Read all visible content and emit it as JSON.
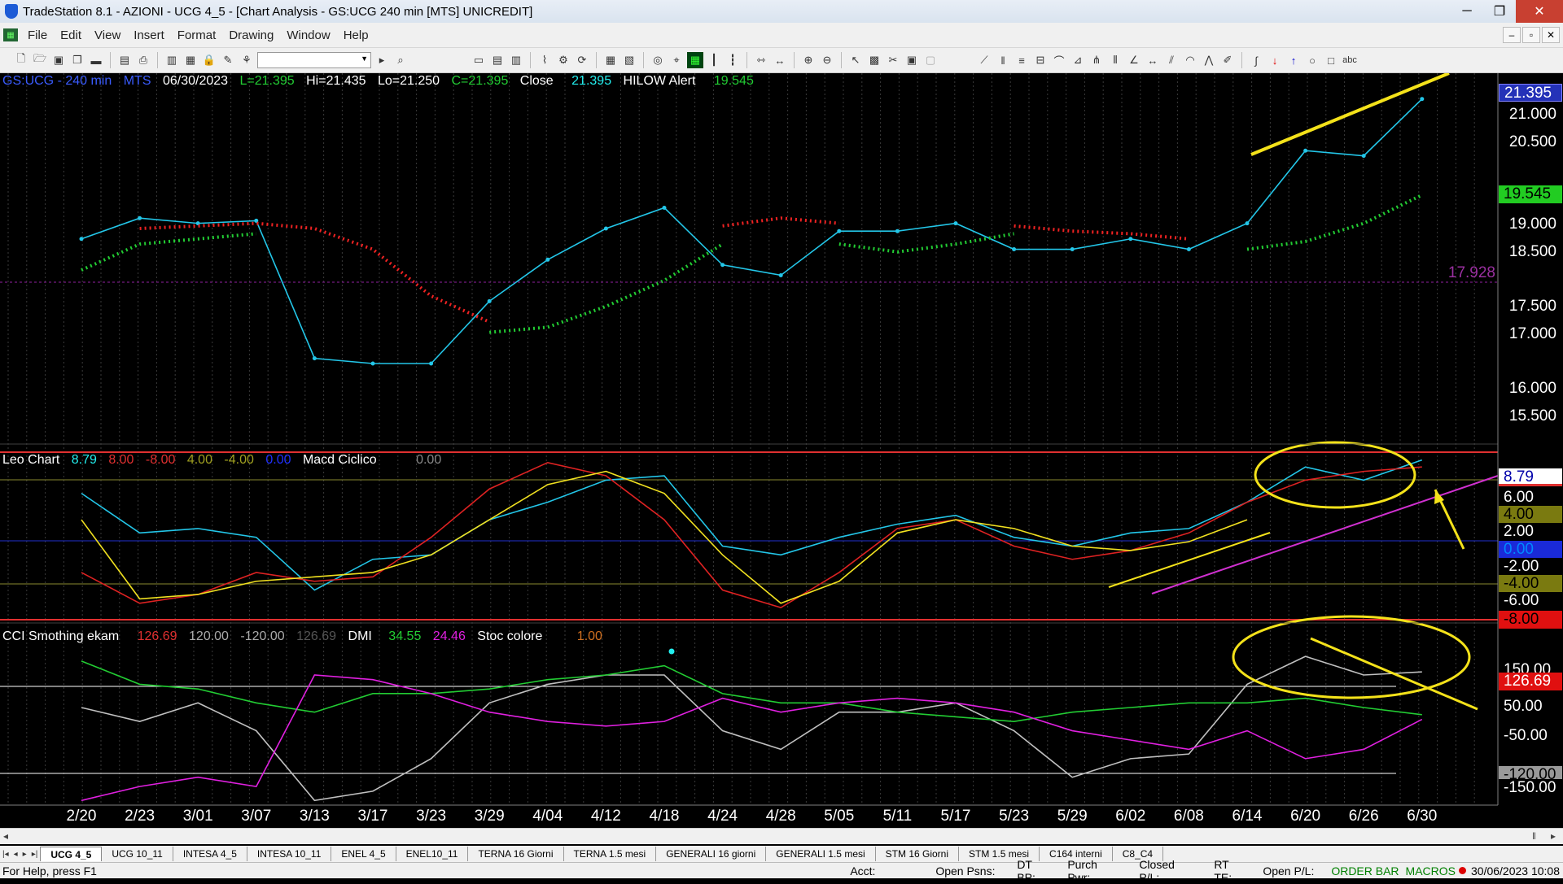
{
  "window": {
    "title": "TradeStation 8.1 - AZIONI - UCG 4_5 - [Chart Analysis - GS:UCG  240 min  [MTS] UNICREDIT]",
    "controls": {
      "minimize": "─",
      "maximize": "❐",
      "close": "✕"
    }
  },
  "menu": [
    "File",
    "Edit",
    "View",
    "Insert",
    "Format",
    "Drawing",
    "Window",
    "Help"
  ],
  "price_pane": {
    "header": {
      "symbol": "GS:UCG - 240 min",
      "session": "MTS",
      "date": "06/30/2023",
      "last": "L=21.395",
      "high": "Hi=21.435",
      "low": "Lo=21.250",
      "close": "C=21.395",
      "close_label": "Close",
      "close_value": "21.395",
      "alert_label": "HILOW Alert",
      "alert_value": "19.545"
    },
    "y_axis": [
      "21.000",
      "20.500",
      "19.000",
      "18.500",
      "17.500",
      "17.000",
      "16.000",
      "15.500"
    ],
    "tags": {
      "last_price": "21.395",
      "alert_price": "19.545",
      "horizontal_line": "17.928"
    }
  },
  "leo_pane": {
    "header": {
      "name": "Leo Chart",
      "v1": "8.79",
      "v2": "8.00",
      "v3": "-8.00",
      "v4": "4.00",
      "v5": "-4.00",
      "v6": "0.00",
      "macd_name": "Macd Ciclico",
      "macd_value": "0.00"
    },
    "tags": [
      "8.79",
      "6.00",
      "4.00",
      "2.00",
      "0.00",
      "-2.00",
      "-4.00",
      "-6.00",
      "-8.00"
    ]
  },
  "cci_pane": {
    "header": {
      "name": "CCI Smothing ekam",
      "v1": "126.69",
      "v2": "120.00",
      "v3": "-120.00",
      "v4": "126.69",
      "dmi_name": "DMI",
      "dmi_plus": "34.55",
      "dmi_minus": "24.46",
      "stoc_name": "Stoc colore",
      "stoc_value": "1.00"
    },
    "tags": [
      "150.00",
      "126.69",
      "50.00",
      "-50.00",
      "-120.00",
      "-150.00"
    ]
  },
  "x_axis": [
    "2/20",
    "2/23",
    "3/01",
    "3/07",
    "3/13",
    "3/17",
    "3/23",
    "3/29",
    "4/04",
    "4/12",
    "4/18",
    "4/24",
    "4/28",
    "5/05",
    "5/11",
    "5/17",
    "5/23",
    "5/29",
    "6/02",
    "6/08",
    "6/14",
    "6/20",
    "6/26",
    "6/30"
  ],
  "tabs": [
    "UCG 4_5",
    "UCG 10_11",
    "INTESA 4_5",
    "INTESA 10_11",
    "ENEL 4_5",
    "ENEL10_11",
    "TERNA 16 Giorni",
    "TERNA 1.5 mesi",
    "GENERALI 16 giorni",
    "GENERALI 1.5 mesi",
    "STM 16 Giorni",
    "STM 1.5 mesi",
    "C164 interni",
    "C8_C4"
  ],
  "status": {
    "help": "For Help, press F1",
    "acct": "Acct:",
    "open_psns": "Open Psns:",
    "dt_bp": "DT BP:",
    "purch_pwr": "Purch Pwr:",
    "closed_pl": "Closed P/L:",
    "rt_te": "RT TE:",
    "open_pl": "Open P/L:",
    "order_bar": "ORDER BAR",
    "macros": "MACROS",
    "datetime": "30/06/2023 10:08"
  },
  "chart_data": [
    {
      "type": "line",
      "title": "GS:UCG - 240 min",
      "x": [
        "2/20",
        "2/23",
        "3/01",
        "3/07",
        "3/13",
        "3/17",
        "3/23",
        "3/29",
        "4/04",
        "4/12",
        "4/18",
        "4/24",
        "4/28",
        "5/05",
        "5/11",
        "5/17",
        "5/23",
        "5/29",
        "6/02",
        "6/08",
        "6/14",
        "6/20",
        "6/26",
        "6/30"
      ],
      "series": [
        {
          "name": "Close",
          "color": "#23c6e8",
          "values": [
            18.7,
            19.1,
            19.0,
            19.05,
            16.4,
            16.3,
            16.3,
            17.5,
            18.3,
            18.9,
            19.3,
            18.2,
            18.0,
            18.85,
            18.85,
            19.0,
            18.5,
            18.5,
            18.7,
            18.5,
            19.0,
            20.4,
            20.3,
            21.395
          ]
        },
        {
          "name": "HILOW Alert",
          "color": "#22cc33",
          "values": [
            18.1,
            18.6,
            18.7,
            18.8,
            null,
            null,
            null,
            16.9,
            17.0,
            17.4,
            17.9,
            18.6,
            null,
            18.6,
            18.45,
            18.6,
            18.8,
            null,
            null,
            null,
            18.5,
            18.65,
            19.0,
            19.545
          ]
        },
        {
          "name": "HILOW Alert (short)",
          "color": "#ee2222",
          "values": [
            null,
            18.9,
            18.95,
            19.0,
            18.9,
            18.5,
            17.6,
            17.1,
            null,
            null,
            null,
            18.95,
            19.1,
            19.0,
            null,
            null,
            18.95,
            18.85,
            18.8,
            18.7,
            null,
            null,
            null,
            null
          ]
        }
      ],
      "ylim": [
        15.0,
        21.5
      ]
    },
    {
      "type": "line",
      "title": "Leo Chart",
      "x": [
        "2/20",
        "2/23",
        "3/01",
        "3/07",
        "3/13",
        "3/17",
        "3/23",
        "3/29",
        "4/04",
        "4/12",
        "4/18",
        "4/24",
        "4/28",
        "5/05",
        "5/11",
        "5/17",
        "5/23",
        "5/29",
        "6/02",
        "6/08",
        "6/14",
        "6/20",
        "6/26",
        "6/30"
      ],
      "series": [
        {
          "name": "Leo Chart",
          "color": "#23c6e8",
          "values": [
            5.0,
            0.5,
            1.0,
            0.0,
            -6.0,
            -2.5,
            -2.0,
            2.0,
            4.0,
            6.5,
            7.0,
            -1.0,
            -2.0,
            0.0,
            1.5,
            2.5,
            0.0,
            -1.0,
            0.5,
            1.0,
            4.0,
            8.0,
            6.5,
            8.79
          ]
        },
        {
          "name": "Ciclo rosso",
          "color": "#dd2222",
          "values": [
            -4.0,
            -7.5,
            -6.5,
            -4.0,
            -5.0,
            -4.5,
            0.0,
            5.5,
            8.5,
            7.0,
            2.0,
            -6.0,
            -8.0,
            -4.0,
            1.0,
            2.0,
            -1.0,
            -2.5,
            -1.5,
            0.5,
            4.0,
            6.5,
            7.5,
            8.0
          ]
        },
        {
          "name": "Ciclo giallo",
          "color": "#f0e020",
          "values": [
            2.0,
            -7.0,
            -6.5,
            -5.0,
            -4.5,
            -4.0,
            -2.0,
            2.0,
            6.0,
            7.5,
            5.0,
            -2.0,
            -7.5,
            -5.0,
            0.5,
            2.0,
            1.0,
            -1.0,
            -1.5,
            -0.5,
            2.0,
            null,
            null,
            null
          ]
        }
      ],
      "ylim": [
        -9.0,
        9.5
      ]
    },
    {
      "type": "line",
      "title": "CCI Smothing ekam",
      "x": [
        "2/20",
        "2/23",
        "3/01",
        "3/07",
        "3/13",
        "3/17",
        "3/23",
        "3/29",
        "4/04",
        "4/12",
        "4/18",
        "4/24",
        "4/28",
        "5/05",
        "5/11",
        "5/17",
        "5/23",
        "5/29",
        "6/02",
        "6/08",
        "6/14",
        "6/20",
        "6/26",
        "6/30"
      ],
      "series": [
        {
          "name": "CCI",
          "color": "#c0c0c0",
          "values": [
            50,
            20,
            60,
            0,
            -150,
            -130,
            -60,
            60,
            100,
            120,
            120,
            0,
            -40,
            40,
            40,
            60,
            0,
            -100,
            -60,
            -50,
            100,
            160,
            120,
            126.69
          ]
        },
        {
          "name": "DMI+",
          "color": "#22cc33",
          "values": [
            150,
            100,
            90,
            60,
            40,
            80,
            80,
            90,
            110,
            120,
            140,
            80,
            60,
            60,
            40,
            30,
            20,
            40,
            50,
            60,
            60,
            70,
            50,
            34.55
          ]
        },
        {
          "name": "DMI-",
          "color": "#e020e0",
          "values": [
            -150,
            -120,
            -100,
            -120,
            120,
            110,
            80,
            40,
            20,
            10,
            20,
            70,
            40,
            60,
            70,
            60,
            40,
            0,
            -20,
            -40,
            0,
            -60,
            -40,
            24.46
          ]
        }
      ],
      "ylim": [
        -160,
        190
      ]
    }
  ]
}
